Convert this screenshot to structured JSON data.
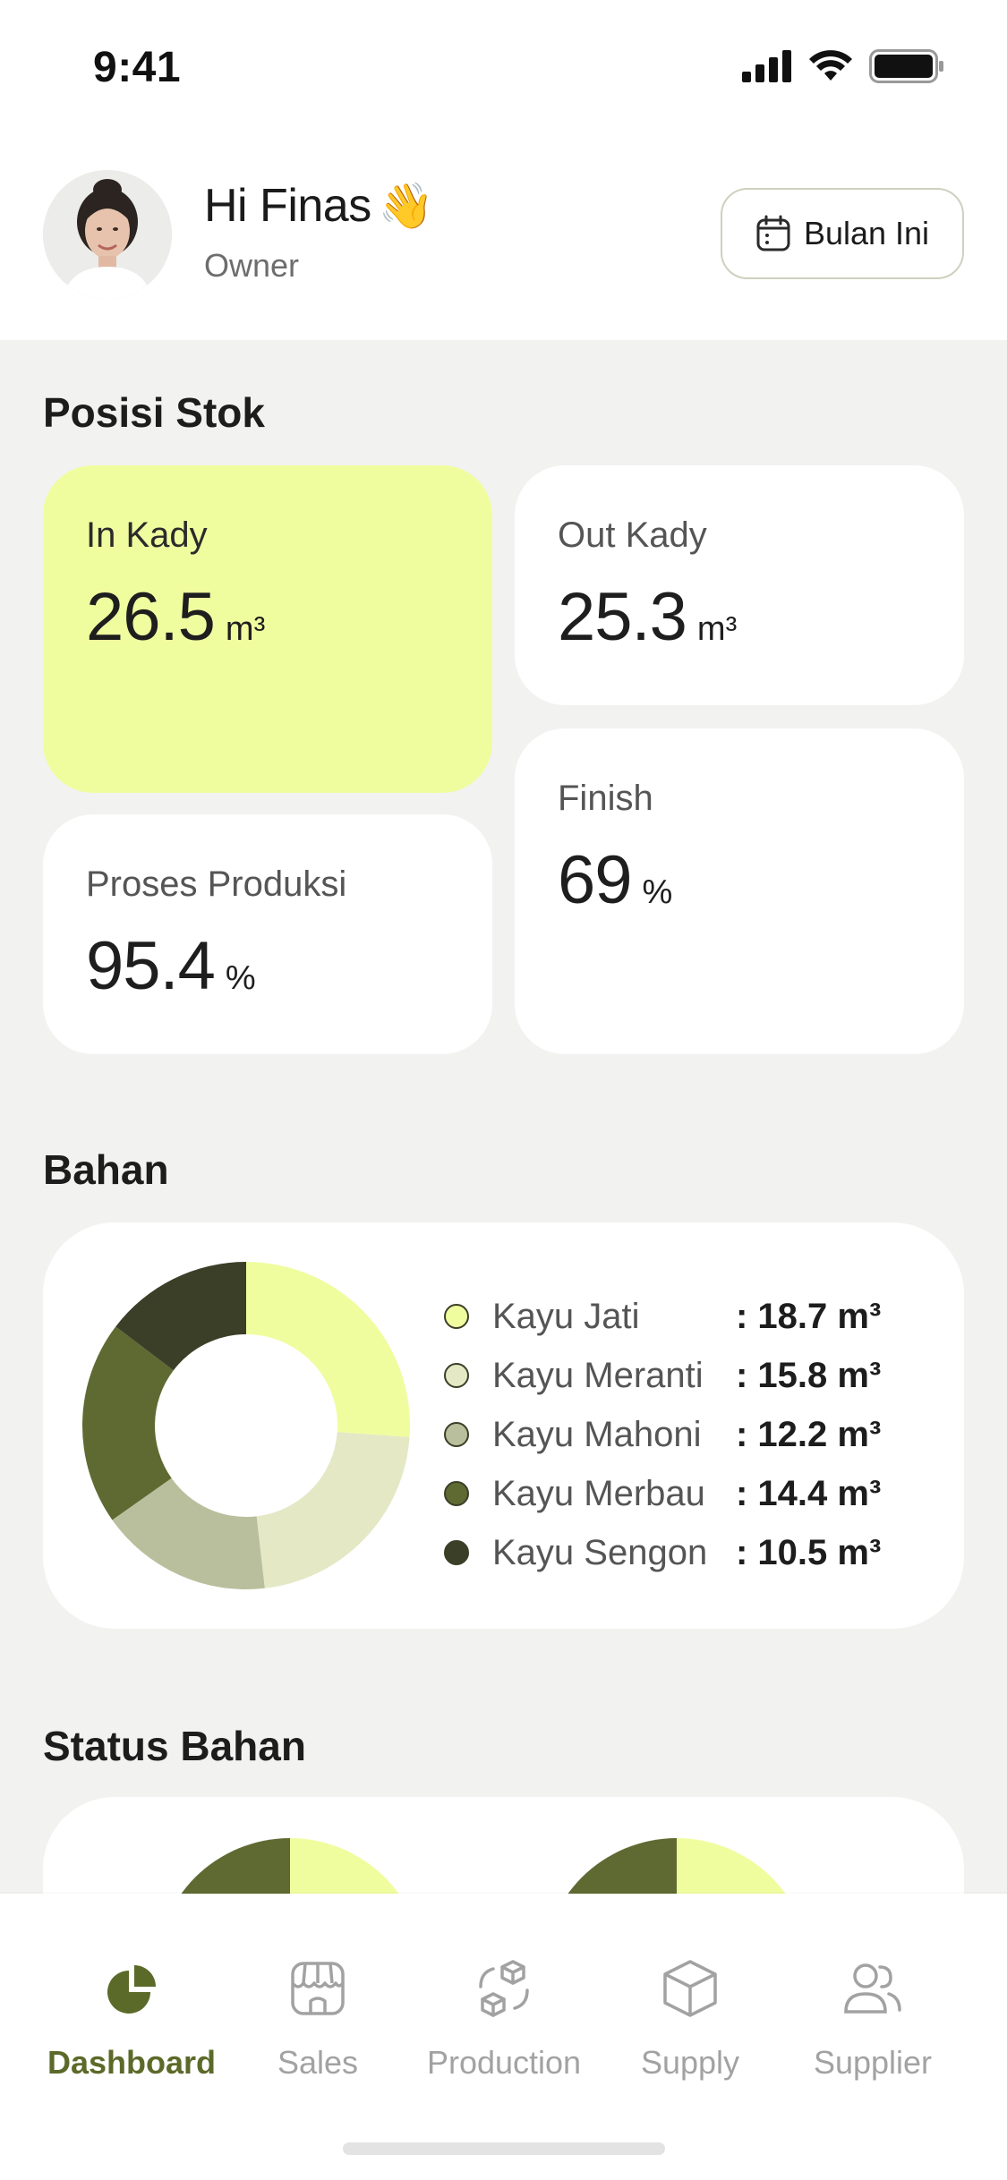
{
  "status_bar": {
    "time": "9:41"
  },
  "header": {
    "greeting": "Hi Finas",
    "wave_emoji": "👋",
    "role": "Owner",
    "period_button": "Bulan Ini"
  },
  "posisi_stok": {
    "title": "Posisi Stok",
    "in_kady": {
      "label": "In Kady",
      "value": "26.5",
      "unit": "m³"
    },
    "out_kady": {
      "label": "Out Kady",
      "value": "25.3",
      "unit": "m³"
    },
    "finish": {
      "label": "Finish",
      "value": "69",
      "unit": "%"
    },
    "proses_produksi": {
      "label": "Proses Produksi",
      "value": "95.4",
      "unit": "%"
    }
  },
  "bahan": {
    "title": "Bahan",
    "items": [
      {
        "name": "Kayu Jati",
        "value": ": 18.7 m³",
        "amount": 18.7,
        "color": "#f0fd9f"
      },
      {
        "name": "Kayu Meranti",
        "value": ": 15.8 m³",
        "amount": 15.8,
        "color": "#e4e8c5"
      },
      {
        "name": "Kayu Mahoni",
        "value": ": 12.2 m³",
        "amount": 12.2,
        "color": "#b9bf9c"
      },
      {
        "name": "Kayu Merbau",
        "value": ": 14.4 m³",
        "amount": 14.4,
        "color": "#5f6a32"
      },
      {
        "name": "Kayu Sengon",
        "value": ": 10.5 m³",
        "amount": 10.5,
        "color": "#3c3f28"
      }
    ]
  },
  "status_bahan": {
    "title": "Status Bahan"
  },
  "bottom_nav": {
    "items": [
      {
        "label": "Dashboard",
        "icon": "pie-chart-icon",
        "active": true
      },
      {
        "label": "Sales",
        "icon": "store-icon",
        "active": false
      },
      {
        "label": "Production",
        "icon": "boxes-cycle-icon",
        "active": false
      },
      {
        "label": "Supply",
        "icon": "box-icon",
        "active": false
      },
      {
        "label": "Supplier",
        "icon": "users-icon",
        "active": false
      }
    ]
  },
  "colors": {
    "accent": "#f0fd9f",
    "primary_dark": "#5b6a29",
    "background": "#f2f2f0"
  }
}
